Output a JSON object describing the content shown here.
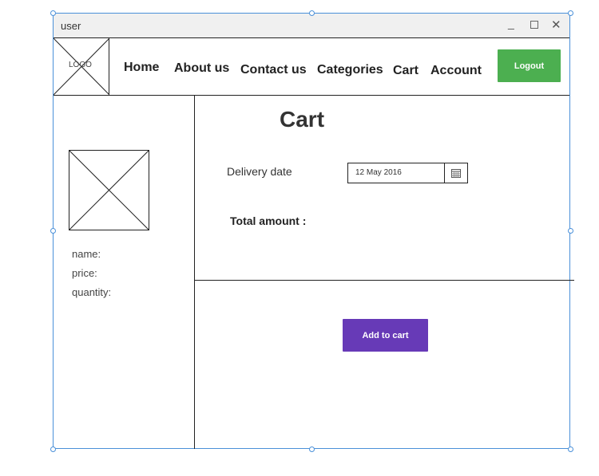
{
  "window": {
    "title": "user"
  },
  "nav": {
    "logo": "LOGO",
    "links": [
      "Home",
      "About us",
      "Contact us",
      "Categories",
      "Cart",
      "Account"
    ],
    "logout_label": "Logout"
  },
  "product": {
    "name_label": "name:",
    "price_label": "price:",
    "quantity_label": "quantity:"
  },
  "cart": {
    "title": "Cart",
    "delivery_label": "Delivery date",
    "delivery_date": "12 May 2016",
    "total_label": "Total amount  :",
    "add_label": "Add to cart"
  },
  "colors": {
    "accent_green": "#4caf50",
    "accent_purple": "#673ab7",
    "selection_blue": "#4a90d9"
  }
}
